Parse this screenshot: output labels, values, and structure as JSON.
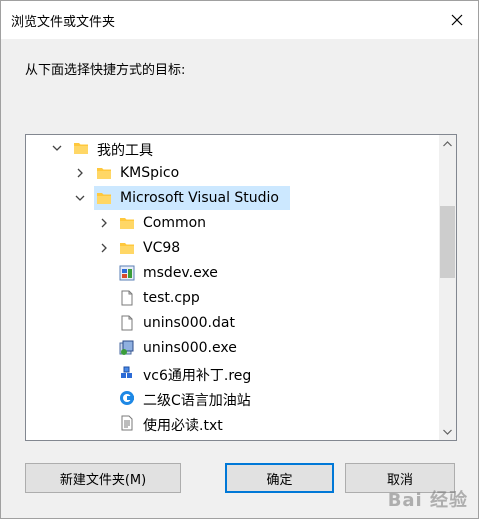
{
  "window": {
    "title": "浏览文件或文件夹"
  },
  "prompt": "从下面选择快捷方式的目标:",
  "tree": {
    "items": [
      {
        "label": "我的工具",
        "icon": "folder-icon",
        "expanded": true
      },
      {
        "label": "KMSpico",
        "icon": "folder-icon",
        "expanded": false
      },
      {
        "label": "Microsoft Visual Studio",
        "icon": "folder-icon",
        "expanded": true,
        "selected": true
      },
      {
        "label": "Common",
        "icon": "folder-icon",
        "expanded": false
      },
      {
        "label": "VC98",
        "icon": "folder-icon",
        "expanded": false
      },
      {
        "label": "msdev.exe",
        "icon": "exe-icon"
      },
      {
        "label": "test.cpp",
        "icon": "file-icon"
      },
      {
        "label": "unins000.dat",
        "icon": "file-icon"
      },
      {
        "label": "unins000.exe",
        "icon": "installer-icon"
      },
      {
        "label": "vc6通用补丁.reg",
        "icon": "registry-icon"
      },
      {
        "label": "二级C语言加油站",
        "icon": "shortcut-icon"
      },
      {
        "label": "使用必读.txt",
        "icon": "text-file-icon"
      }
    ]
  },
  "buttons": {
    "new_folder": "新建文件夹(M)",
    "ok": "确定",
    "cancel": "取消"
  },
  "watermark": "Bai 经验",
  "colors": {
    "selection": "#cce8ff",
    "folder": "#ffc83d",
    "accent": "#0078d7"
  }
}
